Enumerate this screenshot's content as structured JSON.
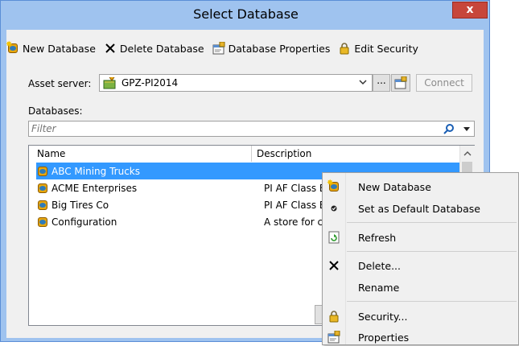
{
  "window": {
    "title": "Select Database",
    "close_glyph": "x"
  },
  "toolbar": {
    "new_database": "New Database",
    "delete_database": "Delete Database",
    "database_properties": "Database Properties",
    "edit_security": "Edit Security"
  },
  "asset_server": {
    "label": "Asset server:",
    "value": "GPZ-PI2014",
    "browse_label": "...",
    "connect_label": "Connect"
  },
  "databases": {
    "label": "Databases:",
    "filter_placeholder": "Filter",
    "columns": {
      "name": "Name",
      "description": "Description"
    },
    "rows": [
      {
        "name": "ABC Mining Trucks",
        "description": ""
      },
      {
        "name": "ACME Enterprises",
        "description": "PI AF Class E"
      },
      {
        "name": "Big Tires Co",
        "description": "PI AF Class E"
      },
      {
        "name": "Configuration",
        "description": "A store for co"
      }
    ],
    "selected_index": 0
  },
  "context_menu": {
    "items": [
      {
        "label": "New Database",
        "icon": "new-database-icon"
      },
      {
        "label": "Set as Default Database",
        "icon": "default-database-icon"
      },
      {
        "label": "Refresh",
        "icon": "refresh-icon"
      },
      {
        "label": "Delete...",
        "icon": "delete-icon"
      },
      {
        "label": "Rename",
        "icon": ""
      },
      {
        "label": "Security...",
        "icon": "lock-icon"
      },
      {
        "label": "Properties",
        "icon": "properties-icon"
      }
    ]
  },
  "colors": {
    "title_bar": "#9fc3ef",
    "close_button": "#c7463a",
    "selection": "#3399ff",
    "dialog_bg": "#f0f0f0"
  }
}
